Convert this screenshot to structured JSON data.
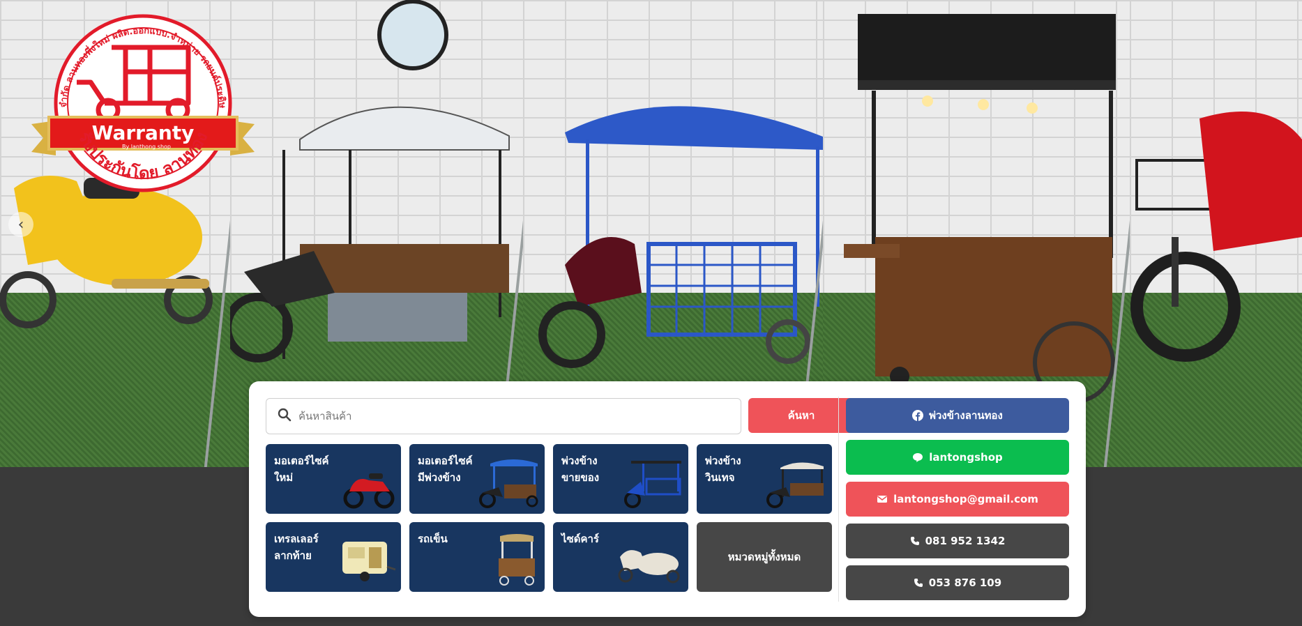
{
  "hero": {
    "badge": {
      "arc_text": "ห้างหุ้นส่วนจำกัด ลานทองพึ่งใหม่ ผลิต.ออกแบบ.จำหน่าย รถยนต์ประดิษฐ์ เพื่อธุรกิจ",
      "ribbon_text": "Warranty",
      "ribbon_sub": "By lanthong shop",
      "bottom_text": "รับประกันโดย ลานทอง"
    },
    "prev_arrow": "‹"
  },
  "search": {
    "placeholder": "ค้นหาสินค้า",
    "button_label": "ค้นหา"
  },
  "categories": [
    {
      "line1": "มอเตอร์ไซค์",
      "line2": "ใหม่"
    },
    {
      "line1": "มอเตอร์ไซค์",
      "line2": "มีพ่วงข้าง"
    },
    {
      "line1": "พ่วงข้าง",
      "line2": "ขายของ"
    },
    {
      "line1": "พ่วงข้าง",
      "line2": "วินเทจ"
    },
    {
      "line1": "เทรลเลอร์",
      "line2": "ลากท้าย"
    },
    {
      "line1": "รถเข็น",
      "line2": ""
    },
    {
      "line1": "ไซด์คาร์",
      "line2": ""
    }
  ],
  "all_categories_label": "หมวดหมู่ทั้งหมด",
  "contacts": [
    {
      "label": "พ่วงข้างลานทอง",
      "icon": "facebook-icon",
      "color": "#3d5b9e"
    },
    {
      "label": "lantongshop",
      "icon": "line-icon",
      "color": "#0bbd4f"
    },
    {
      "label": "lantongshop@gmail.com",
      "icon": "email-icon",
      "color": "#ef5359"
    },
    {
      "label": "081 952 1342",
      "icon": "phone-icon",
      "color": "#474747"
    },
    {
      "label": "053 876 109",
      "icon": "phone-icon",
      "color": "#474747"
    }
  ],
  "colors": {
    "tile": "#183660",
    "accent": "#ef5359",
    "dark": "#474747",
    "footer": "#3a3a3a"
  }
}
